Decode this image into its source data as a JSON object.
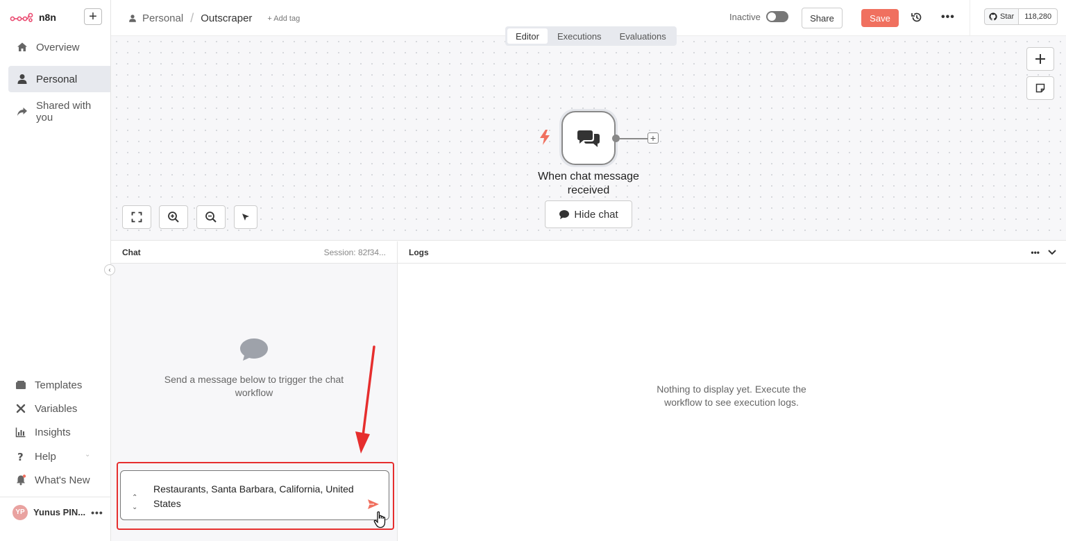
{
  "sidebar": {
    "logo_text": "n8n",
    "add_label": "+",
    "nav": [
      {
        "label": "Overview"
      },
      {
        "label": "Personal"
      },
      {
        "label": "Shared with you"
      }
    ],
    "bottom": [
      {
        "label": "Templates"
      },
      {
        "label": "Variables"
      },
      {
        "label": "Insights"
      },
      {
        "label": "Help"
      },
      {
        "label": "What's New"
      }
    ],
    "user": {
      "initials": "YP",
      "name": "Yunus PIN..."
    }
  },
  "header": {
    "breadcrumb_project": "Personal",
    "breadcrumb_separator": "/",
    "workflow_name": "Outscraper",
    "add_tag": "+ Add tag",
    "status_label": "Inactive",
    "share_label": "Share",
    "save_label": "Save",
    "github": {
      "star_label": "Star",
      "count": "118,280"
    }
  },
  "tabs": [
    {
      "label": "Editor",
      "active": true
    },
    {
      "label": "Executions"
    },
    {
      "label": "Evaluations"
    }
  ],
  "canvas": {
    "node_label": "When chat message received",
    "hide_chat_label": "Hide chat"
  },
  "chat": {
    "title": "Chat",
    "session": "Session: 82f34...",
    "empty_text": "Send a message below to trigger the chat workflow",
    "input_value": "Restaurants, Santa Barbara, California, United States"
  },
  "logs": {
    "title": "Logs",
    "empty_text": "Nothing to display yet. Execute the workflow to see execution logs."
  },
  "colors": {
    "accent": "#f0705f",
    "highlight": "#e62e2e",
    "trigger_bolt": "#f0705f"
  }
}
